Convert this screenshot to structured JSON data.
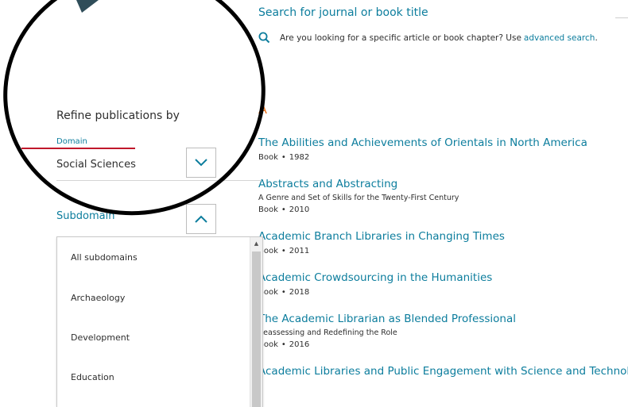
{
  "search": {
    "title": "Search for journal or book title",
    "hint_text": "Are you looking for a specific article or book chapter? Use",
    "hint_link": "advanced search",
    "hint_end": "."
  },
  "sidebar": {
    "refine_title": "Refine publications by",
    "domain_label": "Domain",
    "domain_value": "Social Sciences",
    "subdomain_label": "Subdomain",
    "subdomain_options": [
      "All subdomains",
      "Archaeology",
      "Development",
      "Education"
    ]
  },
  "results": {
    "letter": "A",
    "items": [
      {
        "title": "The Abilities and Achievements of Orientals in North America",
        "subtitle": "",
        "type": "Book",
        "year": "1982"
      },
      {
        "title": "Abstracts and Abstracting",
        "subtitle": "A Genre and Set of Skills for the Twenty-First Century",
        "type": "Book",
        "year": "2010"
      },
      {
        "title": "Academic Branch Libraries in Changing Times",
        "subtitle": "",
        "type": "Book",
        "year": "2011"
      },
      {
        "title": "Academic Crowdsourcing in the Humanities",
        "subtitle": "",
        "type": "Book",
        "year": "2018"
      },
      {
        "title": "The Academic Librarian as Blended Professional",
        "subtitle": "Reassessing and Redefining the Role",
        "type": "Book",
        "year": "2016"
      },
      {
        "title": "Academic Libraries and Public Engagement with Science and Technology",
        "subtitle": "",
        "type": "",
        "year": ""
      }
    ],
    "separator": "•"
  },
  "colors": {
    "link": "#0c7d9d",
    "accent_letter": "#e9711c",
    "annotation": "#000000",
    "underline": "#c0182b"
  }
}
